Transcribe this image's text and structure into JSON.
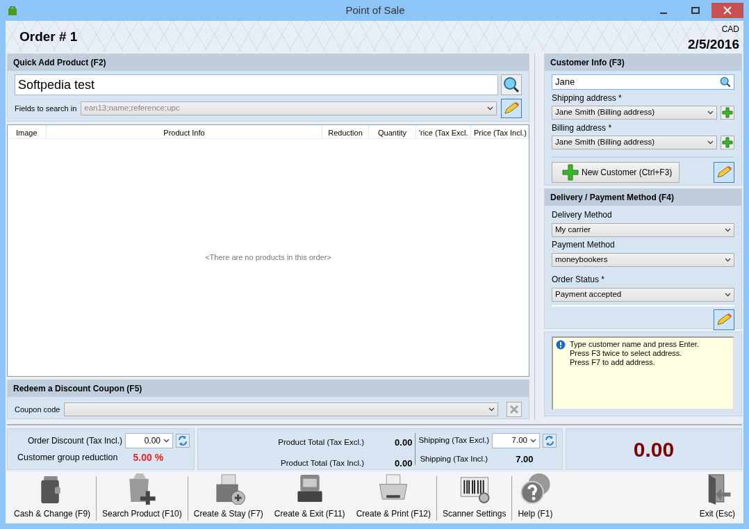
{
  "window": {
    "title": "Point of Sale"
  },
  "header": {
    "order_title": "Order # 1",
    "currency": "CAD",
    "date": "2/5/2016"
  },
  "quick_add": {
    "title": "Quick Add Product (F2)",
    "search_value": "Softpedia test",
    "fields_label": "Fields to search in",
    "fields_value": "ean13;name;reference;upc"
  },
  "products_table": {
    "columns": [
      "Image",
      "Product Info",
      "Reduction",
      "Quantity",
      "'rice (Tax Excl.",
      "Price (Tax Incl.)"
    ],
    "empty_message": "<There are no products in this order>"
  },
  "coupon": {
    "title": "Redeem a Discount Coupon (F5)",
    "label": "Coupon code"
  },
  "customer": {
    "title": "Customer Info (F3)",
    "search_value": "Jane",
    "shipping_label": "Shipping address *",
    "shipping_value": "Jane Smith (Billing address)",
    "billing_label": "Billing address *",
    "billing_value": "Jane Smith (Billing address)",
    "new_customer_button": "New Customer (Ctrl+F3)"
  },
  "delivery": {
    "title": "Delivery / Payment Method (F4)",
    "fields": [
      {
        "label": "Delivery Method",
        "value": "My carrier"
      },
      {
        "label": "Payment Method",
        "value": "moneybookers"
      },
      {
        "label": "Order Status *",
        "value": "Payment accepted"
      }
    ]
  },
  "hint": {
    "lines": [
      "Type customer name and press Enter.",
      "Press F3 twice to select address.",
      "Press F7 to add address."
    ]
  },
  "totals": {
    "order_discount_label": "Order Discount (Tax Incl.)",
    "order_discount_value": "0.00",
    "group_reduction_label": "Customer group reduction",
    "group_reduction_value": "5.00 %",
    "product_total_excl_label": "Product Total (Tax Excl.)",
    "product_total_excl_value": "0.00",
    "product_total_incl_label": "Product Total (Tax Incl.)",
    "product_total_incl_value": "0.00",
    "shipping_excl_label": "Shipping (Tax Excl.)",
    "shipping_excl_value": "7.00",
    "shipping_incl_label": "Shipping (Tax Incl.)",
    "shipping_incl_value": "7.00",
    "grand_total": "0.00"
  },
  "toolbar": [
    {
      "kind": "cash",
      "label": "Cash & Change (F9)"
    },
    {
      "kind": "search",
      "label": "Search Product (F10)"
    },
    {
      "kind": "stay",
      "label": "Create & Stay (F7)"
    },
    {
      "kind": "register",
      "label": "Create & Exit (F11)"
    },
    {
      "kind": "print",
      "label": "Create & Print (F12)"
    },
    {
      "kind": "scanner",
      "label": "Scanner Settings"
    },
    {
      "kind": "help",
      "label": "Help (F1)"
    },
    {
      "kind": "exit",
      "label": "Exit (Esc)"
    }
  ]
}
